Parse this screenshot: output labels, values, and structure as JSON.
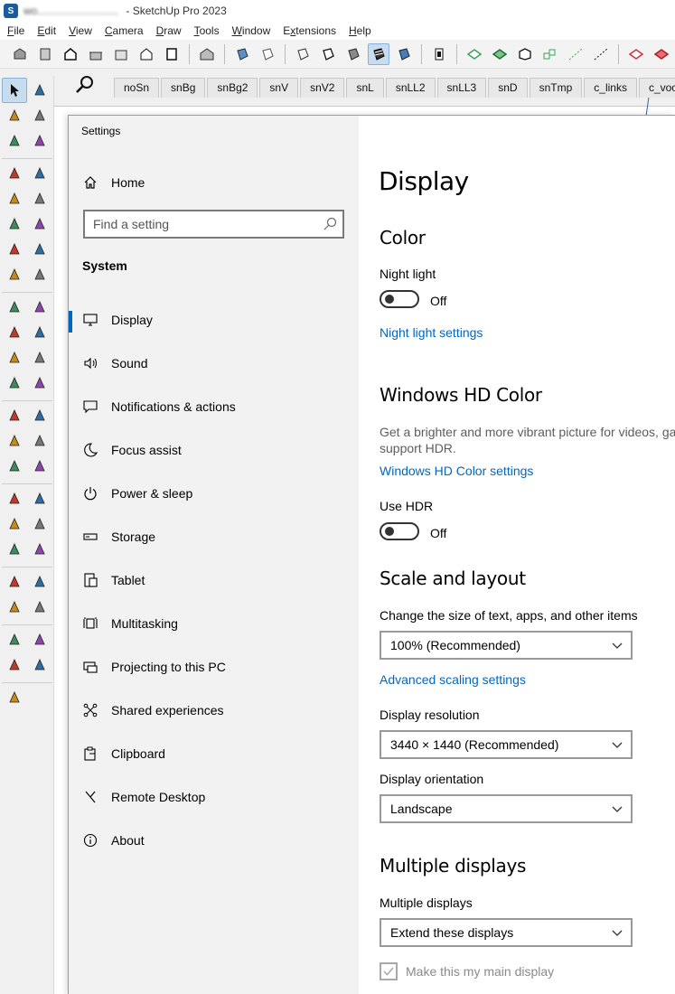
{
  "window": {
    "document_name": "wo...........................",
    "app_title": "- SketchUp Pro 2023"
  },
  "menu": [
    {
      "label": "File",
      "key": "F",
      "rest": "ile"
    },
    {
      "label": "Edit",
      "key": "E",
      "rest": "dit"
    },
    {
      "label": "View",
      "key": "V",
      "rest": "iew"
    },
    {
      "label": "Camera",
      "key": "C",
      "rest": "amera"
    },
    {
      "label": "Draw",
      "key": "D",
      "rest": "raw"
    },
    {
      "label": "Tools",
      "key": "T",
      "rest": "ools"
    },
    {
      "label": "Window",
      "key": "W",
      "rest": "indow"
    },
    {
      "label": "Extensions",
      "key": "x",
      "rest": "tensions",
      "prefix": "E"
    },
    {
      "label": "Help",
      "key": "H",
      "rest": "elp"
    }
  ],
  "scene_tabs": [
    "noSn",
    "snBg",
    "snBg2",
    "snV",
    "snV2",
    "snL",
    "snLL2",
    "snLL3",
    "snD",
    "snTmp",
    "c_links",
    "c_voor"
  ],
  "settings": {
    "window_title": "Settings",
    "home_label": "Home",
    "search_placeholder": "Find a setting",
    "category": "System",
    "nav_items": [
      {
        "label": "Display",
        "icon": "monitor-icon"
      },
      {
        "label": "Sound",
        "icon": "speaker-icon"
      },
      {
        "label": "Notifications & actions",
        "icon": "notification-icon"
      },
      {
        "label": "Focus assist",
        "icon": "moon-icon"
      },
      {
        "label": "Power & sleep",
        "icon": "power-icon"
      },
      {
        "label": "Storage",
        "icon": "storage-icon"
      },
      {
        "label": "Tablet",
        "icon": "tablet-icon"
      },
      {
        "label": "Multitasking",
        "icon": "multitasking-icon"
      },
      {
        "label": "Projecting to this PC",
        "icon": "projecting-icon"
      },
      {
        "label": "Shared experiences",
        "icon": "shared-icon"
      },
      {
        "label": "Clipboard",
        "icon": "clipboard-icon"
      },
      {
        "label": "Remote Desktop",
        "icon": "remote-desktop-icon"
      },
      {
        "label": "About",
        "icon": "info-icon"
      }
    ],
    "selected_nav": "Display",
    "accent_color": "#0067c0"
  },
  "display": {
    "page_title": "Display",
    "color_heading": "Color",
    "night_light_label": "Night light",
    "night_light_state": "Off",
    "night_light_link": "Night light settings",
    "hd_heading": "Windows HD Color",
    "hd_description": "Get a brighter and more vibrant picture for videos, ga support HDR.",
    "hd_link": "Windows HD Color settings",
    "use_hdr_label": "Use HDR",
    "use_hdr_state": "Off",
    "scale_heading": "Scale and layout",
    "scale_label": "Change the size of text, apps, and other items",
    "scale_value": "100% (Recommended)",
    "advanced_scaling_link": "Advanced scaling settings",
    "resolution_label": "Display resolution",
    "resolution_value": "3440 × 1440 (Recommended)",
    "orientation_label": "Display orientation",
    "orientation_value": "Landscape",
    "multi_heading": "Multiple displays",
    "multi_label": "Multiple displays",
    "multi_value": "Extend these displays",
    "main_display_label": "Make this my main display"
  }
}
